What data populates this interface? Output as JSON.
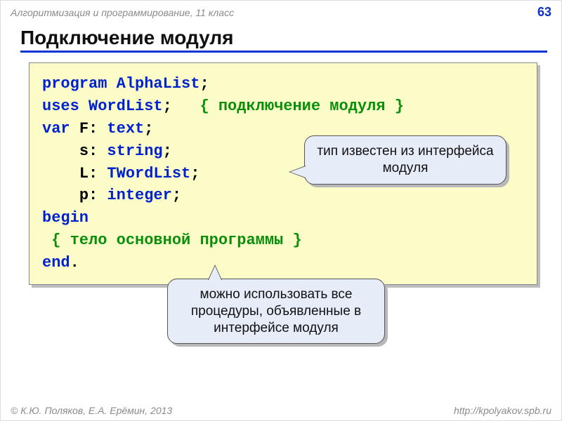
{
  "header": {
    "subject": "Алгоритмизация и программирование, 11 класс",
    "page": "63"
  },
  "title": "Подключение модуля",
  "code": {
    "l1_kw": "program ",
    "l1_name": "AlphaList",
    "l1_end": ";",
    "l2_kw": "uses ",
    "l2_name": "WordList",
    "l2_end": ";   ",
    "l2_comment": "{ подключение модуля }",
    "l3_kw": "var ",
    "l3_name": "F",
    "l3_mid": ": ",
    "l3_type": "text",
    "l3_end": ";",
    "l4_pad": "    ",
    "l4_name": "s",
    "l4_mid": ": ",
    "l4_type": "string",
    "l4_end": ";",
    "l5_pad": "    ",
    "l5_name": "L",
    "l5_mid": ": ",
    "l5_type": "TWordList",
    "l5_end": ";",
    "l6_pad": "    ",
    "l6_name": "p",
    "l6_mid": ": ",
    "l6_type": "integer",
    "l6_end": ";",
    "l7": "begin",
    "l8_pad": " ",
    "l8_comment": "{ тело основной программы }",
    "l9": "end",
    "l9_end": "."
  },
  "callouts": {
    "c1": "тип известен из интерфейса модуля",
    "c2": "можно использовать все процедуры, объявленные в интерфейсе модуля"
  },
  "footer": {
    "left": "© К.Ю. Поляков, Е.А. Ерёмин, 2013",
    "right": "http://kpolyakov.spb.ru"
  }
}
